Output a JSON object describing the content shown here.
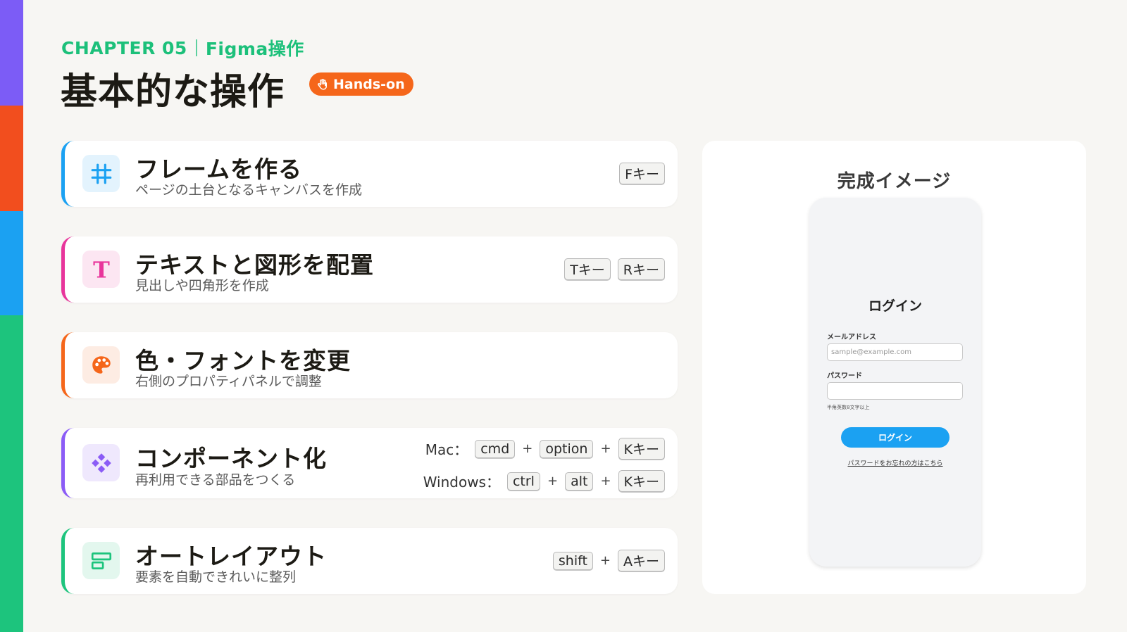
{
  "header": {
    "chapter": "CHAPTER 05",
    "section": "Figma操作",
    "title": "基本的な操作",
    "badge": "Hands-on"
  },
  "colors": {
    "accent_green": "#1cc07a",
    "accent_orange": "#f5661a",
    "stripe": [
      "#7c5cf6",
      "#f24e1e",
      "#1ba1f2",
      "#1dc47d"
    ]
  },
  "cards": [
    {
      "icon": "frame-icon",
      "title": "フレームを作る",
      "subtitle": "ページの土台となるキャンバスを作成",
      "keys": [
        "Fキー"
      ]
    },
    {
      "icon": "text-icon",
      "title": "テキストと図形を配置",
      "subtitle": "見出しや四角形を作成",
      "keys": [
        "Tキー",
        "Rキー"
      ]
    },
    {
      "icon": "palette-icon",
      "title": "色・フォントを変更",
      "subtitle": "右側のプロパティパネルで調整",
      "keys": []
    },
    {
      "icon": "component-icon",
      "title": "コンポーネント化",
      "subtitle": "再利用できる部品をつくる",
      "mac_label": "Mac：",
      "mac_keys": [
        "cmd",
        "option",
        "Kキー"
      ],
      "win_label": "Windows：",
      "win_keys": [
        "ctrl",
        "alt",
        "Kキー"
      ]
    },
    {
      "icon": "auto-layout-icon",
      "title": "オートレイアウト",
      "subtitle": "要素を自動できれいに整列",
      "keys": [
        "shift",
        "Aキー"
      ]
    }
  ],
  "plus": "+",
  "preview": {
    "title": "完成イメージ",
    "login_title": "ログイン",
    "email_label": "メールアドレス",
    "email_placeholder": "sample@example.com",
    "password_label": "パスワード",
    "password_hint": "半角英数8文字以上",
    "login_button": "ログイン",
    "forgot_link": "パスワードをお忘れの方はこちら"
  }
}
